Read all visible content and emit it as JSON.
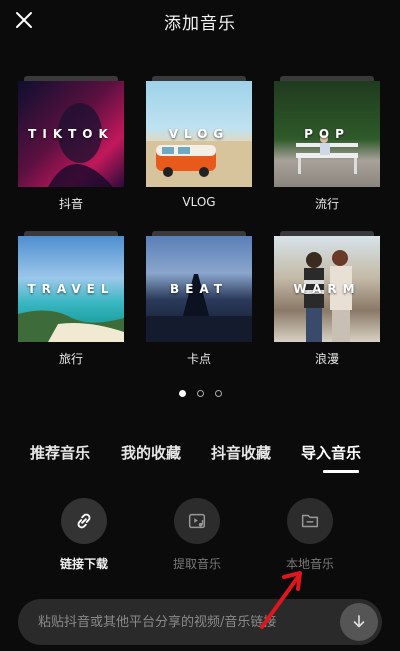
{
  "header": {
    "title": "添加音乐",
    "close_icon": "close-icon"
  },
  "categories": [
    {
      "tag": "TIKTOK",
      "label": "抖音"
    },
    {
      "tag": "VLOG",
      "label": "VLOG"
    },
    {
      "tag": "POP",
      "label": "流行"
    },
    {
      "tag": "TRAVEL",
      "label": "旅行"
    },
    {
      "tag": "BEAT",
      "label": "卡点"
    },
    {
      "tag": "WARM",
      "label": "浪漫"
    }
  ],
  "pager": {
    "count": 3,
    "active": 0
  },
  "tabs": [
    {
      "label": "推荐音乐"
    },
    {
      "label": "我的收藏"
    },
    {
      "label": "抖音收藏"
    },
    {
      "label": "导入音乐",
      "active": true
    }
  ],
  "actions": [
    {
      "label": "链接下载",
      "icon": "link-icon"
    },
    {
      "label": "提取音乐",
      "icon": "video-music-icon"
    },
    {
      "label": "本地音乐",
      "icon": "folder-icon"
    }
  ],
  "paste": {
    "placeholder": "粘贴抖音或其他平台分享的视频/音乐链接",
    "icon": "download-arrow-icon"
  },
  "colors": {
    "background": "#0b0b0b",
    "annotation_arrow": "#e0161e"
  }
}
